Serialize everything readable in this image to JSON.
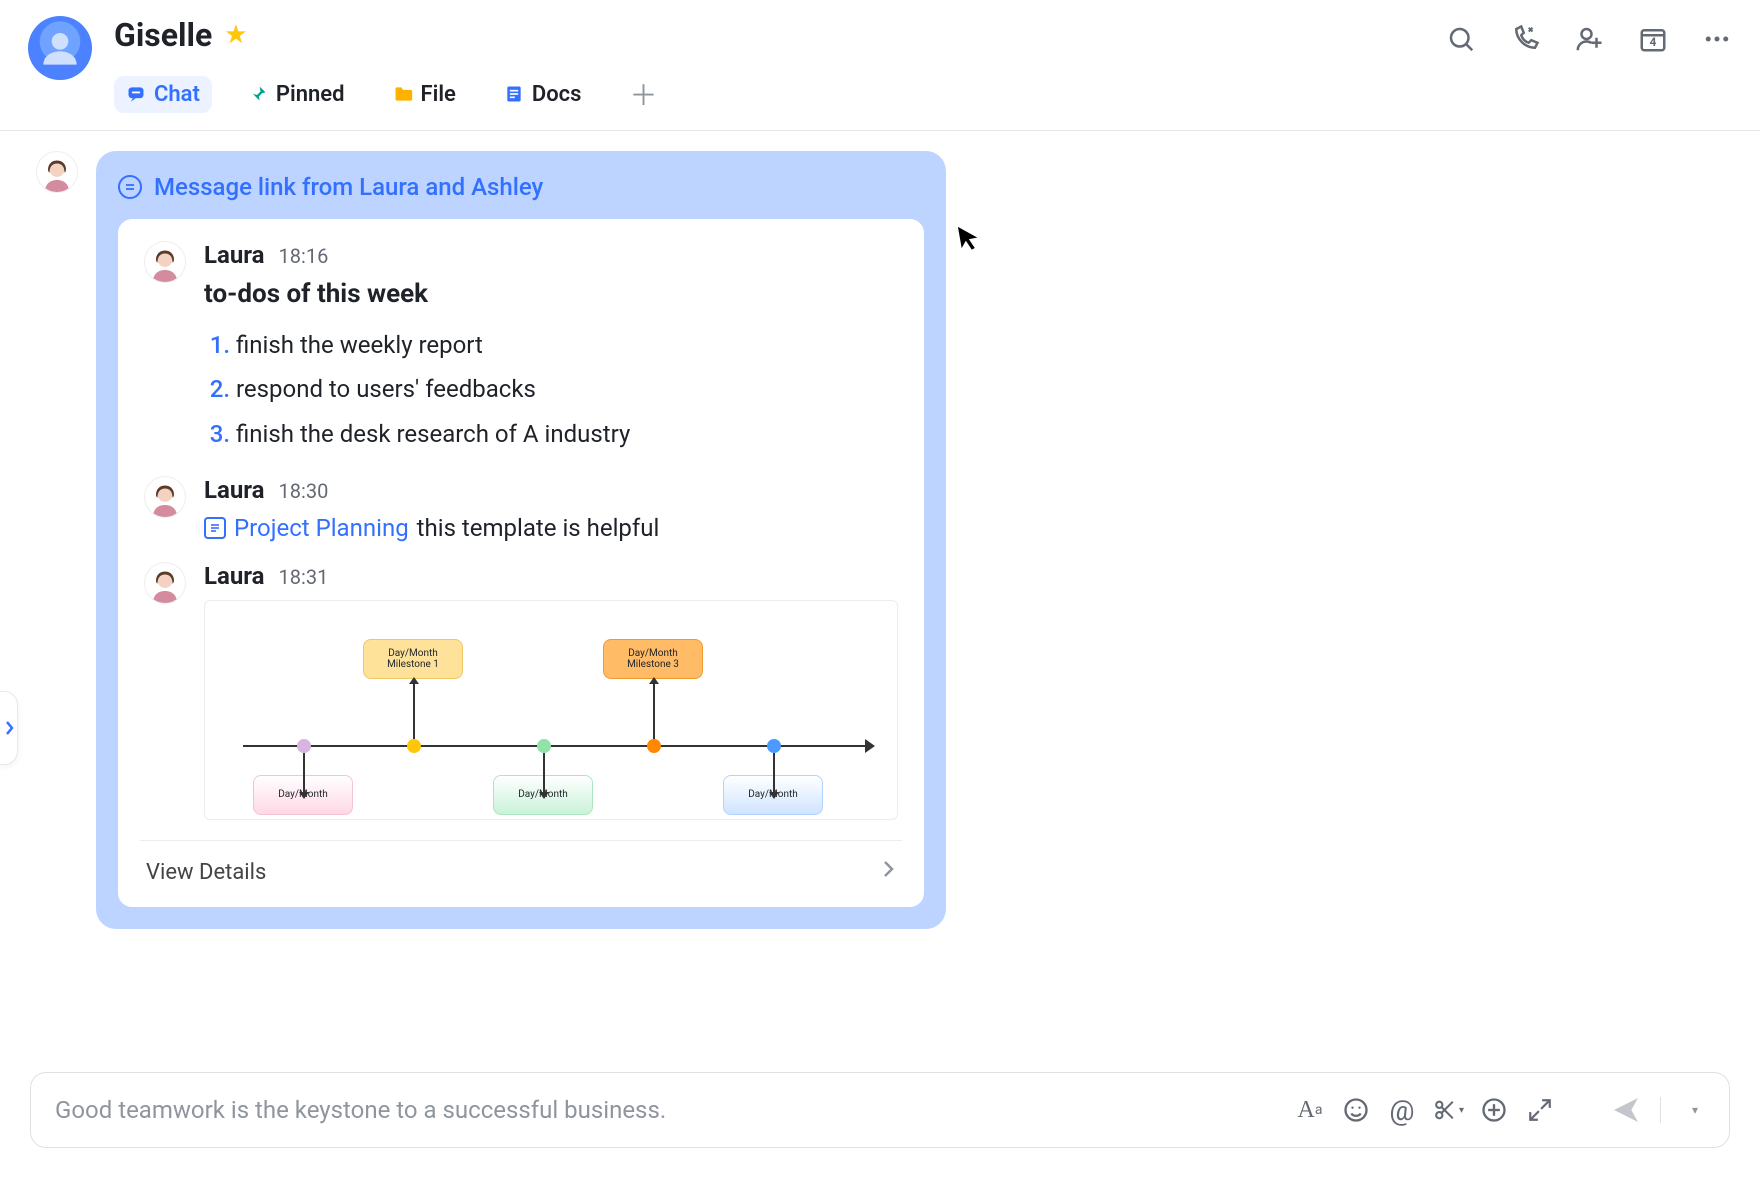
{
  "header": {
    "contact_name": "Giselle",
    "starred": true,
    "tabs": {
      "chat": "Chat",
      "pinned": "Pinned",
      "file": "File",
      "docs": "Docs"
    },
    "calendar_day": "4"
  },
  "message_card": {
    "header": "Message link from Laura and Ashley",
    "messages": [
      {
        "author": "Laura",
        "time": "18:16",
        "subject": "to-dos of this week",
        "items": [
          "finish the weekly report",
          "respond to users' feedbacks",
          "finish the desk research of A industry"
        ]
      },
      {
        "author": "Laura",
        "time": "18:30",
        "doc_name": "Project Planning",
        "trailing_text": "this template is helpful"
      },
      {
        "author": "Laura",
        "time": "18:31",
        "diagram": {
          "milestone_top_1": "Day/Month\nMilestone 1",
          "milestone_top_2": "Day/Month\nMilestone 3",
          "milestone_bottom_1": "Day/Month",
          "milestone_bottom_2": "Day/Month",
          "milestone_bottom_3": "Day/Month"
        }
      }
    ],
    "view_details": "View Details"
  },
  "composer": {
    "placeholder": "Good teamwork is the keystone to a successful business."
  }
}
